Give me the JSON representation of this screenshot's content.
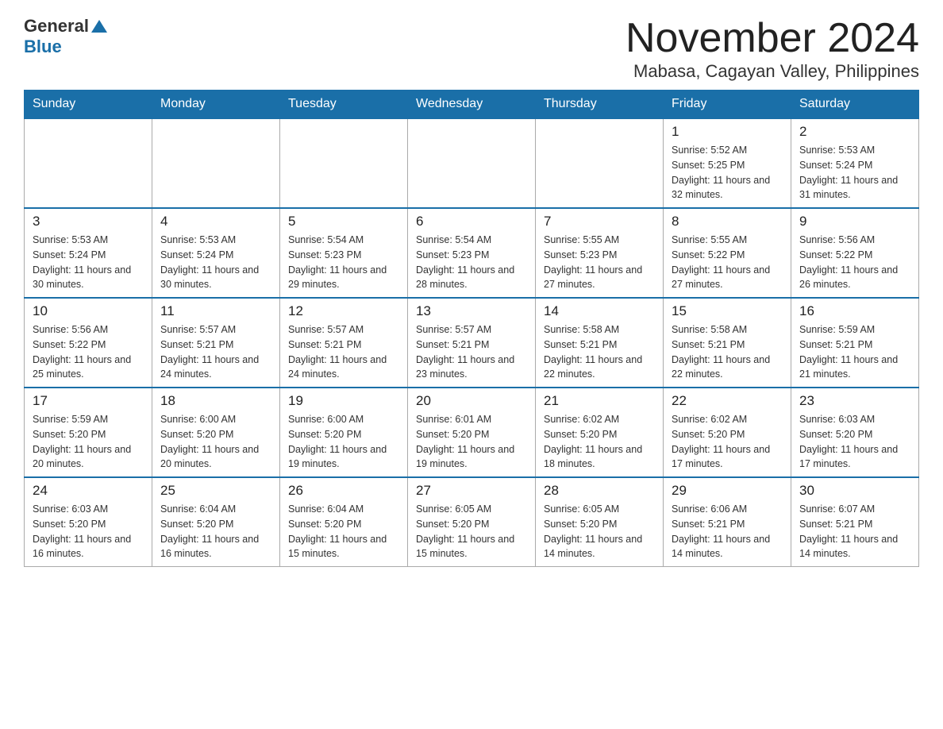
{
  "logo": {
    "general": "General",
    "blue": "Blue"
  },
  "title": {
    "month": "November 2024",
    "location": "Mabasa, Cagayan Valley, Philippines"
  },
  "headers": [
    "Sunday",
    "Monday",
    "Tuesday",
    "Wednesday",
    "Thursday",
    "Friday",
    "Saturday"
  ],
  "weeks": [
    [
      {
        "day": "",
        "info": ""
      },
      {
        "day": "",
        "info": ""
      },
      {
        "day": "",
        "info": ""
      },
      {
        "day": "",
        "info": ""
      },
      {
        "day": "",
        "info": ""
      },
      {
        "day": "1",
        "info": "Sunrise: 5:52 AM\nSunset: 5:25 PM\nDaylight: 11 hours\nand 32 minutes."
      },
      {
        "day": "2",
        "info": "Sunrise: 5:53 AM\nSunset: 5:24 PM\nDaylight: 11 hours\nand 31 minutes."
      }
    ],
    [
      {
        "day": "3",
        "info": "Sunrise: 5:53 AM\nSunset: 5:24 PM\nDaylight: 11 hours\nand 30 minutes."
      },
      {
        "day": "4",
        "info": "Sunrise: 5:53 AM\nSunset: 5:24 PM\nDaylight: 11 hours\nand 30 minutes."
      },
      {
        "day": "5",
        "info": "Sunrise: 5:54 AM\nSunset: 5:23 PM\nDaylight: 11 hours\nand 29 minutes."
      },
      {
        "day": "6",
        "info": "Sunrise: 5:54 AM\nSunset: 5:23 PM\nDaylight: 11 hours\nand 28 minutes."
      },
      {
        "day": "7",
        "info": "Sunrise: 5:55 AM\nSunset: 5:23 PM\nDaylight: 11 hours\nand 27 minutes."
      },
      {
        "day": "8",
        "info": "Sunrise: 5:55 AM\nSunset: 5:22 PM\nDaylight: 11 hours\nand 27 minutes."
      },
      {
        "day": "9",
        "info": "Sunrise: 5:56 AM\nSunset: 5:22 PM\nDaylight: 11 hours\nand 26 minutes."
      }
    ],
    [
      {
        "day": "10",
        "info": "Sunrise: 5:56 AM\nSunset: 5:22 PM\nDaylight: 11 hours\nand 25 minutes."
      },
      {
        "day": "11",
        "info": "Sunrise: 5:57 AM\nSunset: 5:21 PM\nDaylight: 11 hours\nand 24 minutes."
      },
      {
        "day": "12",
        "info": "Sunrise: 5:57 AM\nSunset: 5:21 PM\nDaylight: 11 hours\nand 24 minutes."
      },
      {
        "day": "13",
        "info": "Sunrise: 5:57 AM\nSunset: 5:21 PM\nDaylight: 11 hours\nand 23 minutes."
      },
      {
        "day": "14",
        "info": "Sunrise: 5:58 AM\nSunset: 5:21 PM\nDaylight: 11 hours\nand 22 minutes."
      },
      {
        "day": "15",
        "info": "Sunrise: 5:58 AM\nSunset: 5:21 PM\nDaylight: 11 hours\nand 22 minutes."
      },
      {
        "day": "16",
        "info": "Sunrise: 5:59 AM\nSunset: 5:21 PM\nDaylight: 11 hours\nand 21 minutes."
      }
    ],
    [
      {
        "day": "17",
        "info": "Sunrise: 5:59 AM\nSunset: 5:20 PM\nDaylight: 11 hours\nand 20 minutes."
      },
      {
        "day": "18",
        "info": "Sunrise: 6:00 AM\nSunset: 5:20 PM\nDaylight: 11 hours\nand 20 minutes."
      },
      {
        "day": "19",
        "info": "Sunrise: 6:00 AM\nSunset: 5:20 PM\nDaylight: 11 hours\nand 19 minutes."
      },
      {
        "day": "20",
        "info": "Sunrise: 6:01 AM\nSunset: 5:20 PM\nDaylight: 11 hours\nand 19 minutes."
      },
      {
        "day": "21",
        "info": "Sunrise: 6:02 AM\nSunset: 5:20 PM\nDaylight: 11 hours\nand 18 minutes."
      },
      {
        "day": "22",
        "info": "Sunrise: 6:02 AM\nSunset: 5:20 PM\nDaylight: 11 hours\nand 17 minutes."
      },
      {
        "day": "23",
        "info": "Sunrise: 6:03 AM\nSunset: 5:20 PM\nDaylight: 11 hours\nand 17 minutes."
      }
    ],
    [
      {
        "day": "24",
        "info": "Sunrise: 6:03 AM\nSunset: 5:20 PM\nDaylight: 11 hours\nand 16 minutes."
      },
      {
        "day": "25",
        "info": "Sunrise: 6:04 AM\nSunset: 5:20 PM\nDaylight: 11 hours\nand 16 minutes."
      },
      {
        "day": "26",
        "info": "Sunrise: 6:04 AM\nSunset: 5:20 PM\nDaylight: 11 hours\nand 15 minutes."
      },
      {
        "day": "27",
        "info": "Sunrise: 6:05 AM\nSunset: 5:20 PM\nDaylight: 11 hours\nand 15 minutes."
      },
      {
        "day": "28",
        "info": "Sunrise: 6:05 AM\nSunset: 5:20 PM\nDaylight: 11 hours\nand 14 minutes."
      },
      {
        "day": "29",
        "info": "Sunrise: 6:06 AM\nSunset: 5:21 PM\nDaylight: 11 hours\nand 14 minutes."
      },
      {
        "day": "30",
        "info": "Sunrise: 6:07 AM\nSunset: 5:21 PM\nDaylight: 11 hours\nand 14 minutes."
      }
    ]
  ]
}
